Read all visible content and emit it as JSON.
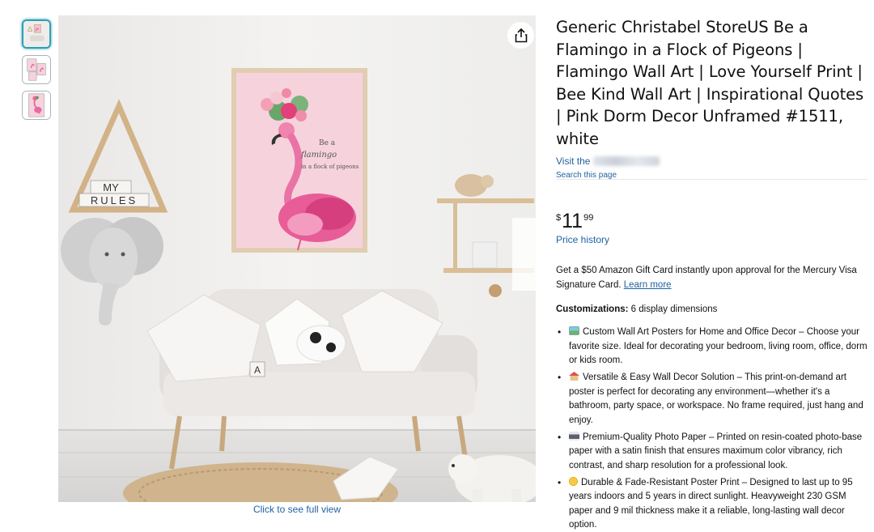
{
  "thumbnails": [
    {
      "icon": "thumbnail-living-room"
    },
    {
      "icon": "thumbnail-flamingo-frames"
    },
    {
      "icon": "thumbnail-flamingo-print"
    }
  ],
  "main_image": {
    "frame_text": [
      "Be a",
      "flamingo",
      "in a flock of pigeons"
    ],
    "shelf_letters": {
      "line1": "MY",
      "line2": "RULES"
    },
    "cushion_letter": "A",
    "share_icon": "share-icon"
  },
  "full_view_label": "Click to see full view",
  "product": {
    "title": "Generic Christabel StoreUS Be a Flamingo in a Flock of Pigeons | Flamingo Wall Art | Love Yourself Print | Bee Kind Wall Art | Inspirational Quotes | Pink Dorm Decor Unframed #1511, white",
    "visit_store_label": "Visit the",
    "search_page_label": "Search this page",
    "price": {
      "symbol": "$",
      "whole": "11",
      "fraction": "99"
    },
    "price_history_label": "Price history",
    "promo_text": "Get a $50 Amazon Gift Card instantly upon approval for the Mercury Visa Signature Card.",
    "promo_link": "Learn more",
    "customizations_label": "Customizations:",
    "customizations_value": "6 display dimensions",
    "bullets": [
      {
        "icon": "picture-icon",
        "text": "Custom Wall Art Posters for Home and Office Decor – Choose your favorite size. Ideal for decorating your bedroom, living room, office, dorm or kids room."
      },
      {
        "icon": "house-icon",
        "text": "Versatile & Easy Wall Decor Solution – This print-on-demand art poster is perfect for decorating any environment—whether it's a bathroom, party space, or workspace. No frame required, just hang and enjoy."
      },
      {
        "icon": "printer-icon",
        "text": "Premium-Quality Photo Paper – Printed on resin-coated photo-base paper with a satin finish that ensures maximum color vibrancy, rich contrast, and sharp resolution for a professional look."
      },
      {
        "icon": "smiley-icon",
        "text": "Durable & Fade-Resistant Poster Print – Designed to last up to 95 years indoors and 5 years in direct sunlight. Heavyweight 230 GSM paper and 9 mil thickness make it a reliable, long-lasting wall decor option."
      }
    ]
  },
  "colors": {
    "link": "#2162a1",
    "text": "#0f1111",
    "thumb_selected": "#2f9fb5",
    "flamingo": "#e86aa3",
    "poster_bg": "#f6d3dc"
  }
}
